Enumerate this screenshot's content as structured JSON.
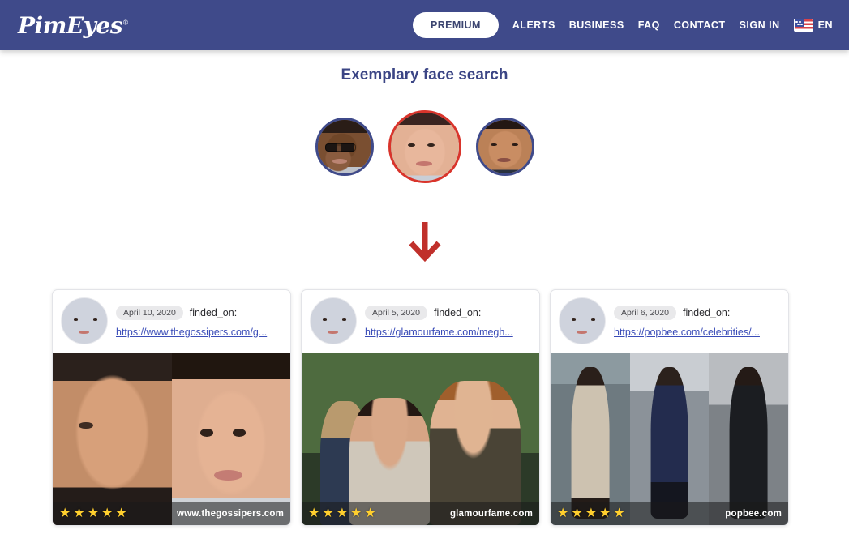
{
  "header": {
    "logo_text": "PimEyes",
    "premium_label": "PREMIUM",
    "nav": [
      {
        "label": "ALERTS"
      },
      {
        "label": "BUSINESS"
      },
      {
        "label": "FAQ"
      },
      {
        "label": "CONTACT"
      },
      {
        "label": "SIGN IN"
      }
    ],
    "language_label": "EN",
    "background_color": "#3f4a8a"
  },
  "main": {
    "title": "Exemplary face search",
    "avatars": [
      {
        "name": "avatar-left",
        "selected": false,
        "border_color": "#3f4a8a"
      },
      {
        "name": "avatar-center",
        "selected": true,
        "border_color": "#d9342b"
      },
      {
        "name": "avatar-right",
        "selected": false,
        "border_color": "#3f4a8a"
      }
    ],
    "arrow_color": "#c0302b",
    "results": [
      {
        "date": "April 10, 2020",
        "found_label": "finded_on:",
        "url": "https://www.thegossipers.com/g...",
        "domain": "www.thegossipers.com",
        "stars": 5
      },
      {
        "date": "April 5, 2020",
        "found_label": "finded_on:",
        "url": "https://glamourfame.com/megh...",
        "domain": "glamourfame.com",
        "stars": 5
      },
      {
        "date": "April 6, 2020",
        "found_label": "finded_on:",
        "url": "https://popbee.com/celebrities/...",
        "domain": "popbee.com",
        "stars": 5
      }
    ]
  }
}
